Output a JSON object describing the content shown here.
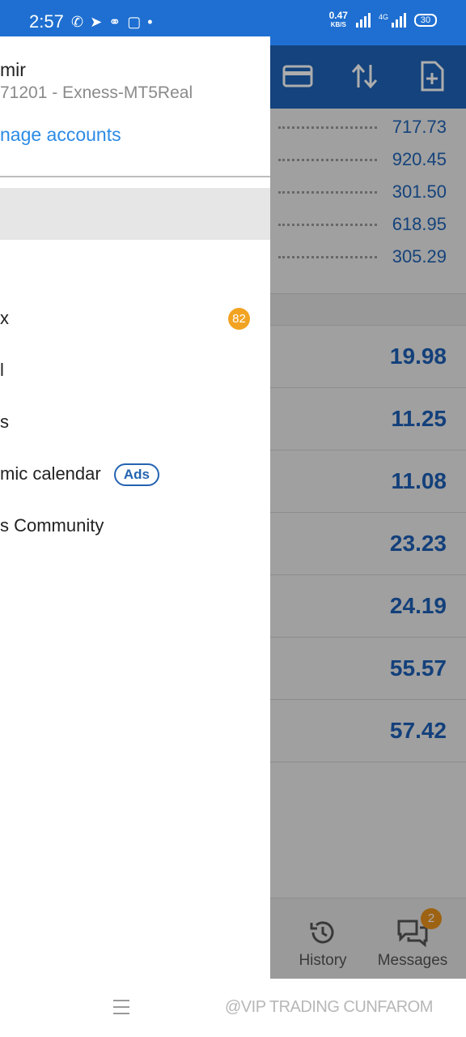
{
  "status_bar": {
    "time": "2:57",
    "net_speed": "0.47",
    "net_unit": "KB/S",
    "network": "4G",
    "battery": "30"
  },
  "quotes": {
    "small_values": [
      "717.73",
      "920.45",
      "301.50",
      "618.95",
      "305.29"
    ],
    "large_values": [
      "19.98",
      "11.25",
      "11.08",
      "23.23",
      "24.19",
      "55.57",
      "57.42"
    ]
  },
  "drawer": {
    "account_name": "mir",
    "account_number": "71201 - Exness-MT5Real",
    "manage_accounts": "nage accounts",
    "menu_items": [
      {
        "label": "x",
        "count": "82"
      },
      {
        "label": "l"
      },
      {
        "label": "s"
      },
      {
        "label": "mic calendar",
        "tag": "Ads"
      },
      {
        "label": "s Community"
      }
    ]
  },
  "bottom_nav": {
    "history": "History",
    "messages": "Messages",
    "messages_badge": "2"
  },
  "watermark": "@VIP TRADING CUNFAROM",
  "colors": {
    "accent": "#1e6fd1",
    "link": "#2b8be6",
    "badge": "#f1a321",
    "quote": "#1d5fb5"
  }
}
